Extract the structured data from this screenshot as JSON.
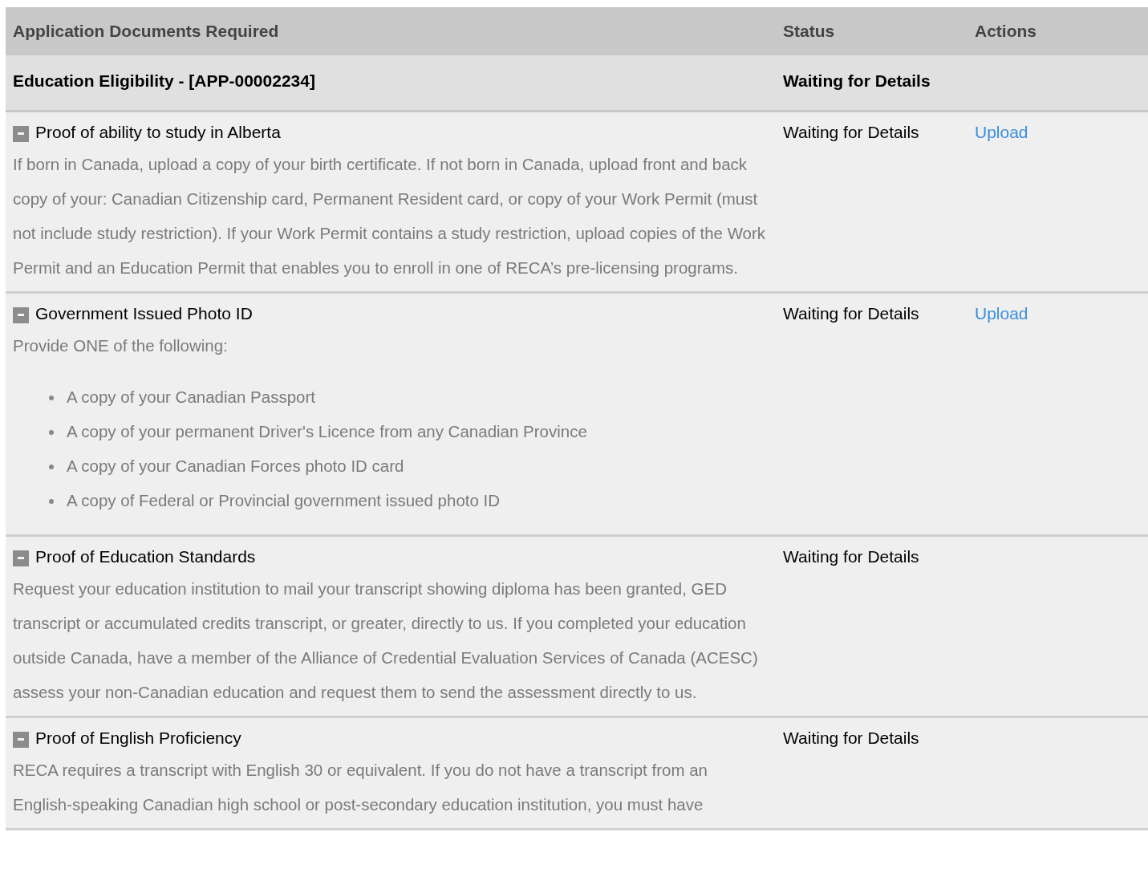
{
  "table": {
    "columns": [
      "Application Documents Required",
      "Status",
      "Actions"
    ],
    "group": {
      "title": "Education Eligibility - [APP-00002234]",
      "status": "Waiting for Details"
    },
    "rows": [
      {
        "title": "Proof of ability to study in Alberta",
        "expanded": true,
        "status": "Waiting for Details",
        "action": "Upload",
        "description": "If born in Canada, upload a copy of your birth certificate. If not born in Canada, upload front and back copy of your: Canadian Citizenship card, Permanent Resident card, or copy of your Work Permit (must not include study restriction). If your Work Permit contains a study restriction, upload copies of the Work Permit and an Education Permit that enables you to enroll in one of RECA’s pre-licensing programs."
      },
      {
        "title": "Government Issued Photo ID",
        "expanded": true,
        "status": "Waiting for Details",
        "action": "Upload",
        "description": "Provide ONE of the following:",
        "bullets": [
          "A copy of your Canadian Passport",
          "A copy of your permanent Driver's Licence from any Canadian Province",
          "A copy of your Canadian Forces photo ID card",
          "A copy of Federal or Provincial government issued photo ID"
        ]
      },
      {
        "title": "Proof of Education Standards",
        "expanded": true,
        "status": "Waiting for Details",
        "description": "Request your education institution to mail your transcript showing diploma has been granted, GED transcript or accumulated credits transcript, or greater, directly to us. If you completed your education outside Canada, have a member of the Alliance of Credential Evaluation Services of Canada (ACESC) assess your non-Canadian education and request them to send the assessment directly to us."
      },
      {
        "title": "Proof of English Proficiency",
        "expanded": true,
        "status": "Waiting for Details",
        "description": "RECA requires a transcript with English 30 or equivalent. If you do not have a transcript from an English-speaking Canadian high school or post-secondary education institution, you must have"
      }
    ]
  }
}
